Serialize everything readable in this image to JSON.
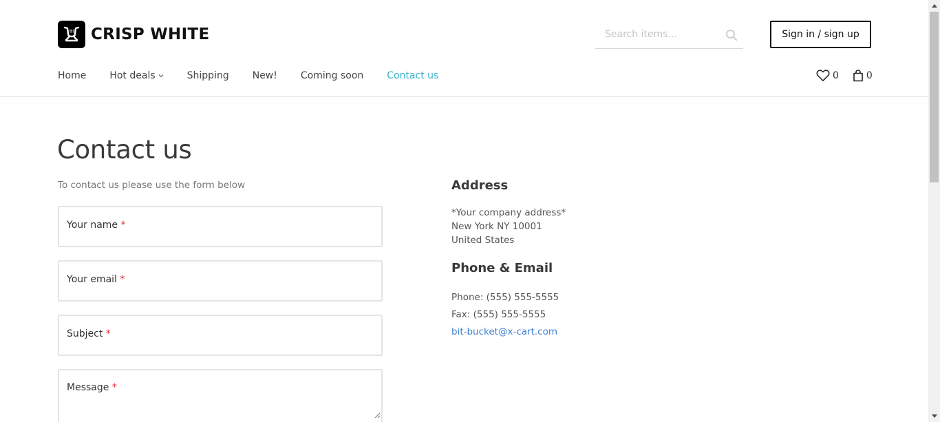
{
  "brand": {
    "name": "CRISP WHITE"
  },
  "search": {
    "placeholder": "Search items..."
  },
  "header": {
    "signin_label": "Sign in / sign up"
  },
  "nav": {
    "items": [
      {
        "label": "Home"
      },
      {
        "label": "Hot deals"
      },
      {
        "label": "Shipping"
      },
      {
        "label": "New!"
      },
      {
        "label": "Coming soon"
      },
      {
        "label": "Contact us"
      }
    ],
    "active": "Contact us"
  },
  "counters": {
    "wishlist": "0",
    "cart": "0"
  },
  "page": {
    "title": "Contact us",
    "intro": "To contact us please use the form below"
  },
  "form": {
    "required_mark": "*",
    "fields": [
      {
        "label": "Your name"
      },
      {
        "label": "Your email"
      },
      {
        "label": "Subject"
      },
      {
        "label": "Message"
      }
    ]
  },
  "contact": {
    "address_heading": "Address",
    "address_lines": [
      "*Your company address*",
      "New York NY 10001",
      "United States"
    ],
    "phone_heading": "Phone & Email",
    "phone": "Phone: (555) 555-5555",
    "fax": "Fax: (555) 555-5555",
    "email": "bit-bucket@x-cart.com"
  },
  "colors": {
    "accent": "#36b0cc",
    "link": "#3f7fd1",
    "required": "#e5323c"
  },
  "icons": {
    "logo": "cart-logo-icon",
    "search": "search-icon",
    "caret": "chevron-down-icon",
    "wishlist": "heart-icon",
    "cart": "shopping-bag-icon"
  }
}
